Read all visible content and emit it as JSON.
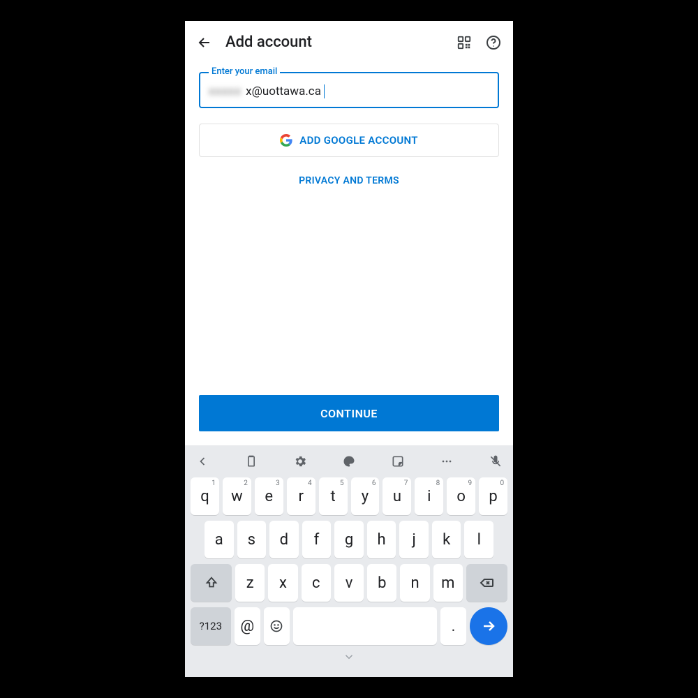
{
  "header": {
    "title": "Add account"
  },
  "email_field": {
    "label": "Enter your email",
    "masked_prefix": "xxxxx",
    "visible_value": "x@uottawa.ca"
  },
  "google_button": {
    "label": "ADD GOOGLE ACCOUNT"
  },
  "privacy_link": "PRIVACY AND TERMS",
  "continue_button": "CONTINUE",
  "keyboard": {
    "row1": [
      {
        "k": "q",
        "n": "1"
      },
      {
        "k": "w",
        "n": "2"
      },
      {
        "k": "e",
        "n": "3"
      },
      {
        "k": "r",
        "n": "4"
      },
      {
        "k": "t",
        "n": "5"
      },
      {
        "k": "y",
        "n": "6"
      },
      {
        "k": "u",
        "n": "7"
      },
      {
        "k": "i",
        "n": "8"
      },
      {
        "k": "o",
        "n": "9"
      },
      {
        "k": "p",
        "n": "0"
      }
    ],
    "row2": [
      "a",
      "s",
      "d",
      "f",
      "g",
      "h",
      "j",
      "k",
      "l"
    ],
    "row3": [
      "z",
      "x",
      "c",
      "v",
      "b",
      "n",
      "m"
    ],
    "symbols_key": "?123",
    "at_key": "@",
    "period_key": "."
  }
}
